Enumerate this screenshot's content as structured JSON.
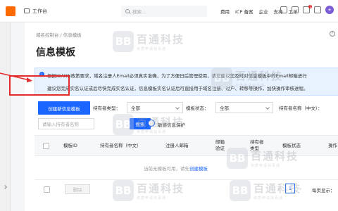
{
  "topbar": {
    "workspace_label": "工作台",
    "search_placeholder": "搜索...",
    "menu": [
      "费用",
      "ICP 备案",
      "企业",
      "支持",
      "工单"
    ],
    "notification_count": "1",
    "avatar_glyph": "+"
  },
  "breadcrumb": {
    "items": [
      "域名控制台",
      "信息模板"
    ],
    "separator": "/"
  },
  "page": {
    "title": "信息模板",
    "help": "?"
  },
  "notice": {
    "line1": "根据ICANN政策要求，域名注册人Email必须真实准确，为了方便日后管理使用，请您建议您及时对信息模板中的Email邮箱进行",
    "line2_prefix": "建议您完成实名认证或后尽快完成实名认证，信息模板实名认证后可直接用于域名注册、过户、转移等操作，加快操作审核进程。"
  },
  "toolbar": {
    "create_label": "创建新信息模板",
    "holder_type_label": "持有者类型：",
    "holder_type_value": "全部",
    "template_status_label": "模板状态：",
    "template_status_value": "全部",
    "holder_name_label": "持有者名称（中文）：",
    "holder_name_placeholder": "请输入持有者名称",
    "search_label": "搜索",
    "privacy_label": "敏感信息保护"
  },
  "table": {
    "columns": [
      "模板ID",
      "持有者名称（中文）",
      "注册人邮箱",
      "邮箱验证",
      "持有者类型",
      "模板状态",
      "操作"
    ],
    "empty_prefix": "当前无模板可用，请先",
    "empty_link": "创建模板"
  },
  "footer": {
    "delete_label": "删除",
    "prev": "‹",
    "next": "›",
    "page": "1",
    "page_size_label": "每页显示："
  },
  "watermark": {
    "logo": "BB",
    "main": "百通科技",
    "sub": "资质申请找百通"
  },
  "colors": {
    "primary": "#1a66ff",
    "highlight_box": "#e42a2a",
    "notice_bg": "#e8f2ff"
  }
}
